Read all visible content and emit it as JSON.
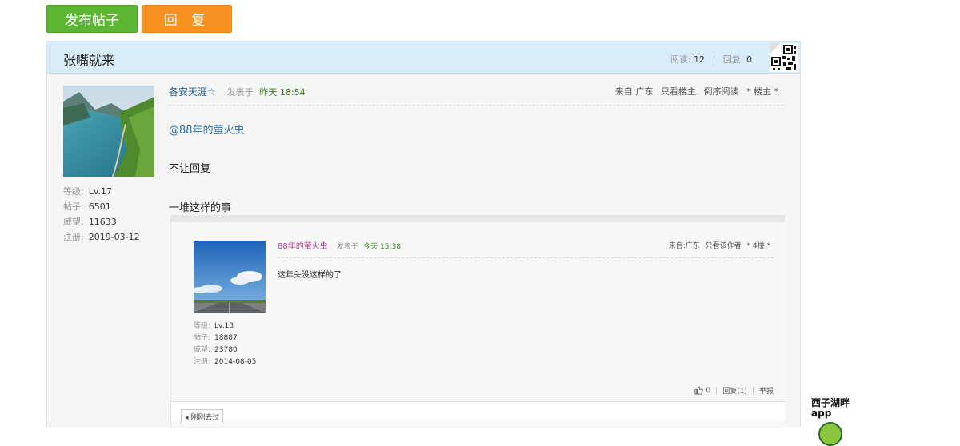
{
  "toolbar": {
    "post_label": "发布帖子",
    "reply_label": "回 复"
  },
  "thread": {
    "title": "张嘴就来",
    "read_label": "阅读:",
    "read_count": "12",
    "reply_label": "回复:",
    "reply_count": "0"
  },
  "post": {
    "author": "各安天涯☆",
    "posted_label": "发表于",
    "posted_time": "昨天 18:54",
    "tools": [
      "来自:广东",
      "只看楼主",
      "倒序阅读",
      "* 楼主 *"
    ],
    "lines": [
      "@88年的萤火虫",
      "不让回复",
      "一堆这样的事"
    ],
    "user": {
      "level_label": "等级:",
      "level": "Lv.17",
      "posts_label": "帖子:",
      "posts": "6501",
      "rep_label": "威望:",
      "rep": "11633",
      "reg_label": "注册:",
      "reg": "2019-03-12"
    }
  },
  "quote": {
    "author": "88年的萤火虫",
    "posted_label": "发表于",
    "posted_time": "今天 15:38",
    "tools": [
      "来自:广东",
      "只看该作者",
      "* 4楼 *"
    ],
    "body": "这年头没这样的了",
    "user": {
      "level_label": "等级:",
      "level": "Lv.18",
      "posts_label": "帖子:",
      "posts": "18887",
      "rep_label": "威望:",
      "rep": "23780",
      "reg_label": "注册:",
      "reg": "2014-08-05"
    },
    "like_count": "0",
    "reply_link": "回复(1)",
    "report_link": "举报",
    "prev_button": "◂ 刚刚去过"
  },
  "brand": {
    "line1": "西子湖畔",
    "line2": "app"
  },
  "colors": {
    "post_button": "#5cb533",
    "reply_button": "#f7911f",
    "header_bg": "#d9ecf9",
    "author": "#1f5fa8",
    "quote_author": "#b23b8c",
    "time": "#3a7d1c"
  }
}
